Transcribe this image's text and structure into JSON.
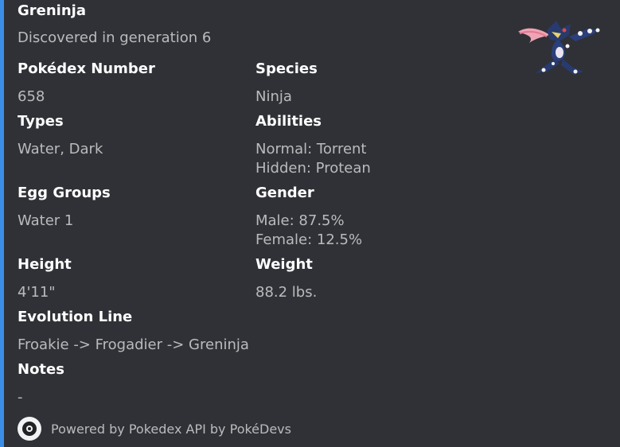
{
  "embed": {
    "accent_color": "#3a8ee6",
    "title": "Greninja",
    "description": "Discovered in generation 6",
    "thumbnail_icon": "greninja-sprite-icon",
    "fields": {
      "pokedex_number": {
        "name": "Pokédex Number",
        "value": "658"
      },
      "species": {
        "name": "Species",
        "value": "Ninja"
      },
      "types": {
        "name": "Types",
        "value": "Water, Dark"
      },
      "abilities": {
        "name": "Abilities",
        "value": "Normal: Torrent\nHidden: Protean"
      },
      "egg_groups": {
        "name": "Egg Groups",
        "value": "Water 1"
      },
      "gender": {
        "name": "Gender",
        "value": "Male: 87.5%\nFemale: 12.5%"
      },
      "height": {
        "name": "Height",
        "value": "4'11\""
      },
      "weight": {
        "name": "Weight",
        "value": "88.2 lbs."
      },
      "evolution_line": {
        "name": "Evolution Line",
        "value": "Froakie -> Frogadier -> Greninja"
      },
      "notes": {
        "name": "Notes",
        "value": "-"
      }
    },
    "footer": {
      "icon": "pokedevs-logo-icon",
      "text": "Powered by Pokedex API by PokéDevs"
    }
  }
}
